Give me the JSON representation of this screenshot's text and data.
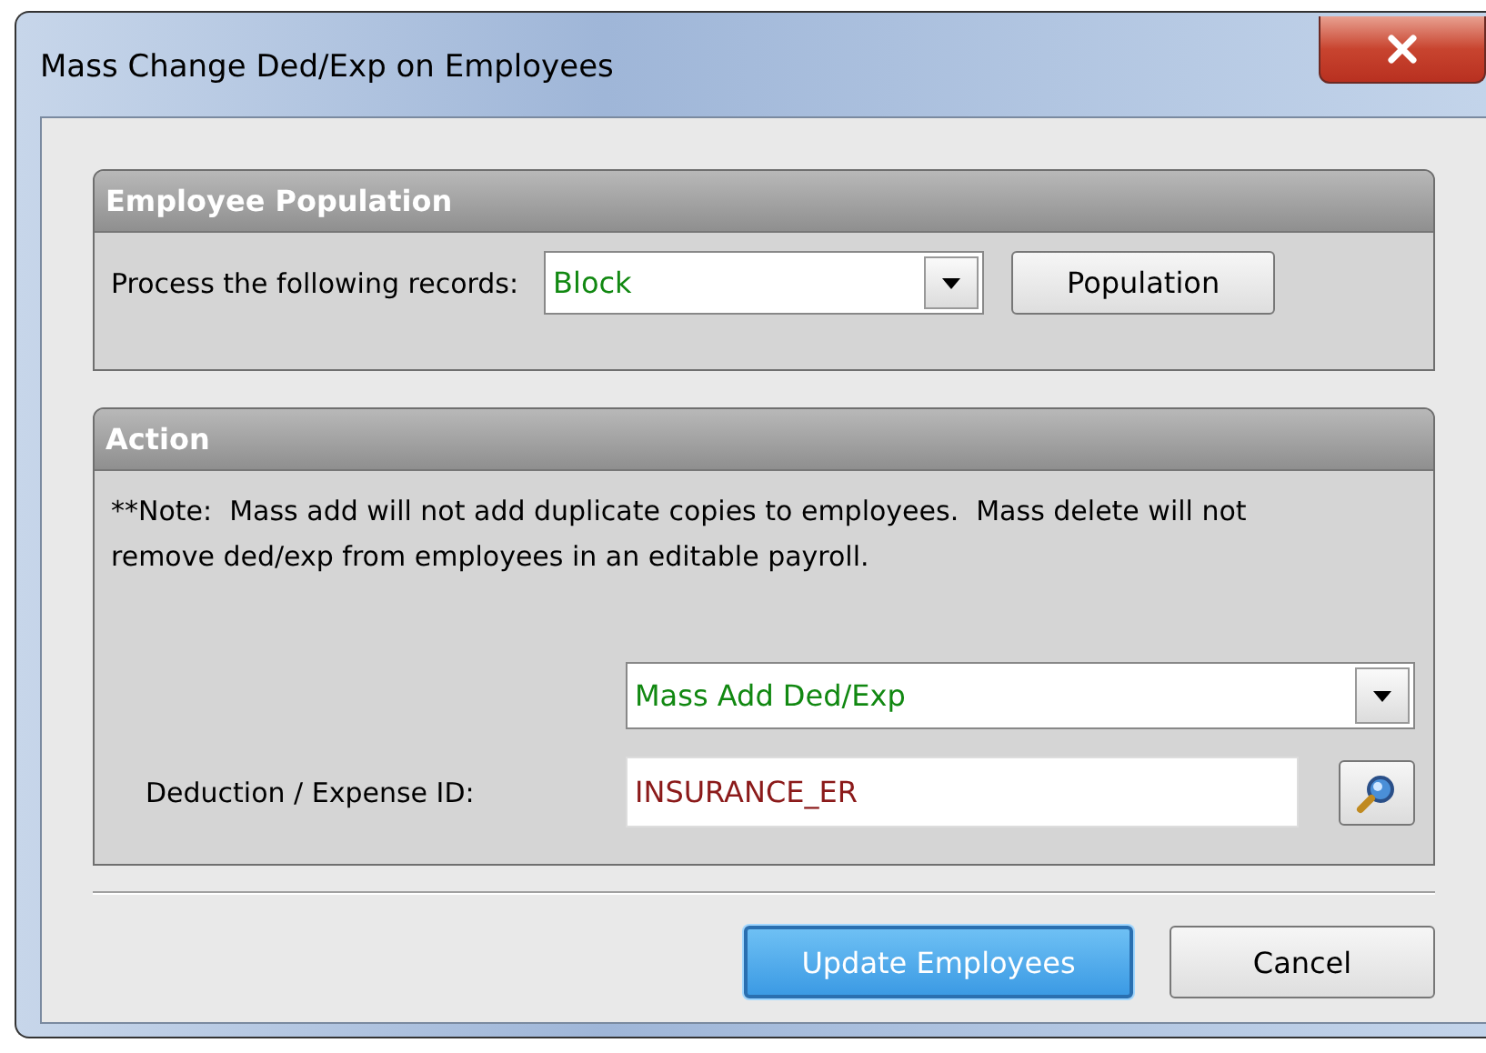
{
  "window": {
    "title": "Mass Change Ded/Exp on Employees"
  },
  "population_group": {
    "title": "Employee Population",
    "label": "Process the following records:",
    "records_dropdown": {
      "value": "Block"
    },
    "button": "Population"
  },
  "action_group": {
    "title": "Action",
    "note": "**Note:  Mass add will not add duplicate copies to employees.  Mass delete will not remove ded/exp from employees in an editable payroll.",
    "action_dropdown": {
      "value": "Mass Add Ded/Exp"
    },
    "id_label": "Deduction / Expense ID:",
    "id_field": {
      "value": "INSURANCE_ER"
    }
  },
  "buttons": [
    {
      "label": "Update Employees",
      "default": true
    },
    {
      "label": "Cancel",
      "default": false
    }
  ]
}
